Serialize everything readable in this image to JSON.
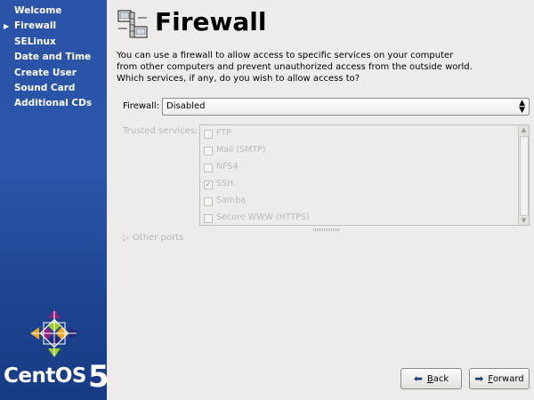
{
  "sidebar": {
    "items": [
      {
        "label": "Welcome",
        "active": false
      },
      {
        "label": "Firewall",
        "active": true
      },
      {
        "label": "SELinux",
        "active": false
      },
      {
        "label": "Date and Time",
        "active": false
      },
      {
        "label": "Create User",
        "active": false
      },
      {
        "label": "Sound Card",
        "active": false
      },
      {
        "label": "Additional CDs",
        "active": false
      }
    ],
    "brand_text": "CentOS",
    "brand_version": "5"
  },
  "header": {
    "title": "Firewall",
    "icon": "firewall-icon"
  },
  "intro": "You can use a firewall to allow access to specific services on your computer from other computers and prevent unauthorized access from the outside world.  Which services, if any, do you wish to allow access to?",
  "firewall": {
    "label": "Firewall:",
    "selected": "Disabled"
  },
  "trusted": {
    "label": "Trusted services:",
    "services": [
      {
        "name": "FTP",
        "checked": false
      },
      {
        "name": "Mail (SMTP)",
        "checked": false
      },
      {
        "name": "NFS4",
        "checked": false
      },
      {
        "name": "SSH",
        "checked": true
      },
      {
        "name": "Samba",
        "checked": false
      },
      {
        "name": "Secure WWW (HTTPS)",
        "checked": false
      }
    ]
  },
  "other_ports": {
    "label": "Other ports"
  },
  "buttons": {
    "back_prefix": "",
    "back_mnemonic": "B",
    "back_rest": "ack",
    "forward_prefix": "",
    "forward_mnemonic": "F",
    "forward_rest": "orward"
  },
  "colors": {
    "sidebar_bg": "#2a55a8",
    "window_bg": "#edeceb",
    "disabled_text": "#bab8b4"
  }
}
